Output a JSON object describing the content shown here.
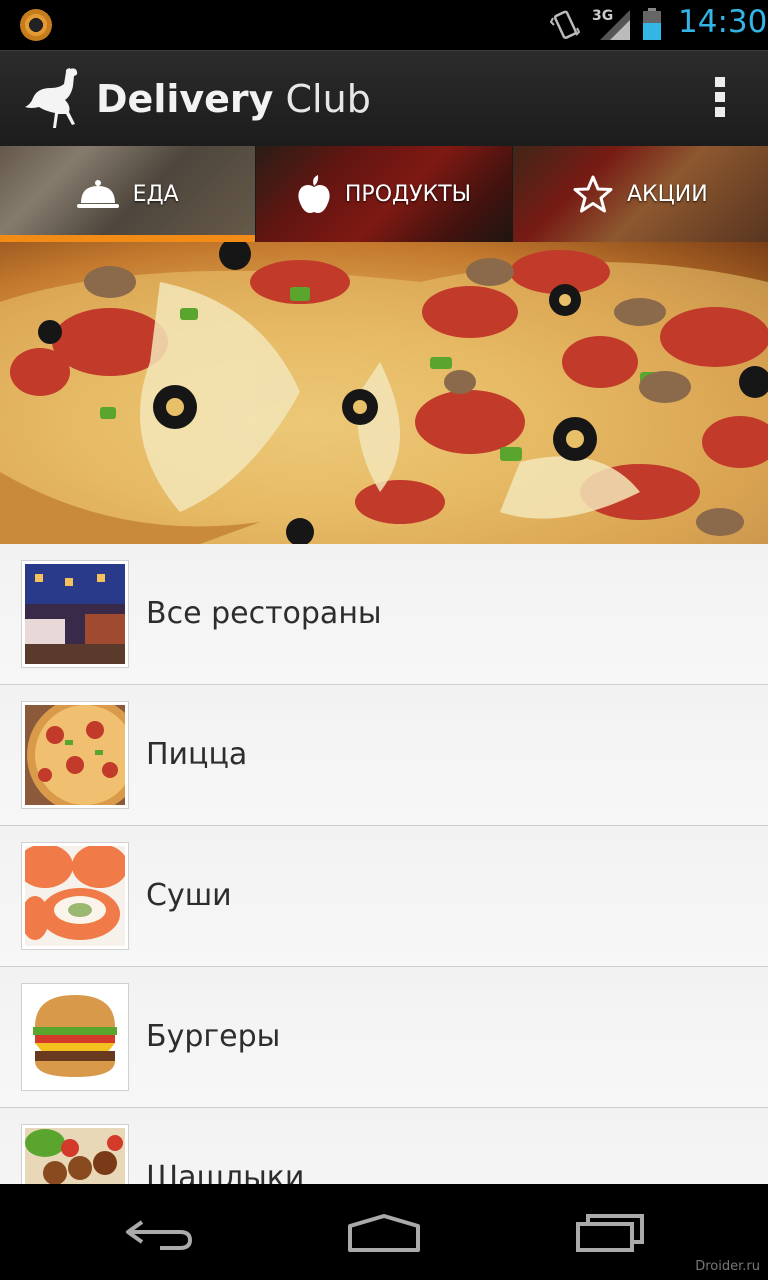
{
  "status_bar": {
    "time": "14:30",
    "network": "3G",
    "notification_icon": "app-notification-icon",
    "clock_color": "#33b5e5"
  },
  "action_bar": {
    "title_bold": "Delivery",
    "title_light": "Club",
    "logo_icon": "ostrich-logo-icon",
    "menu_icon": "overflow-menu-icon"
  },
  "tabs": [
    {
      "label": "ЕДА",
      "icon": "cloche-icon",
      "active": true
    },
    {
      "label": "ПРОДУКТЫ",
      "icon": "apple-icon",
      "active": false
    },
    {
      "label": "АКЦИИ",
      "icon": "star-icon",
      "active": false
    }
  ],
  "accent_color": "#f28c17",
  "categories": [
    {
      "label": "Все рестораны",
      "image": "restaurant-interior"
    },
    {
      "label": "Пицца",
      "image": "pizza"
    },
    {
      "label": "Суши",
      "image": "sushi-rolls"
    },
    {
      "label": "Бургеры",
      "image": "burger"
    },
    {
      "label": "Шашлыки",
      "image": "skewers"
    }
  ],
  "watermark": "Droider.ru"
}
